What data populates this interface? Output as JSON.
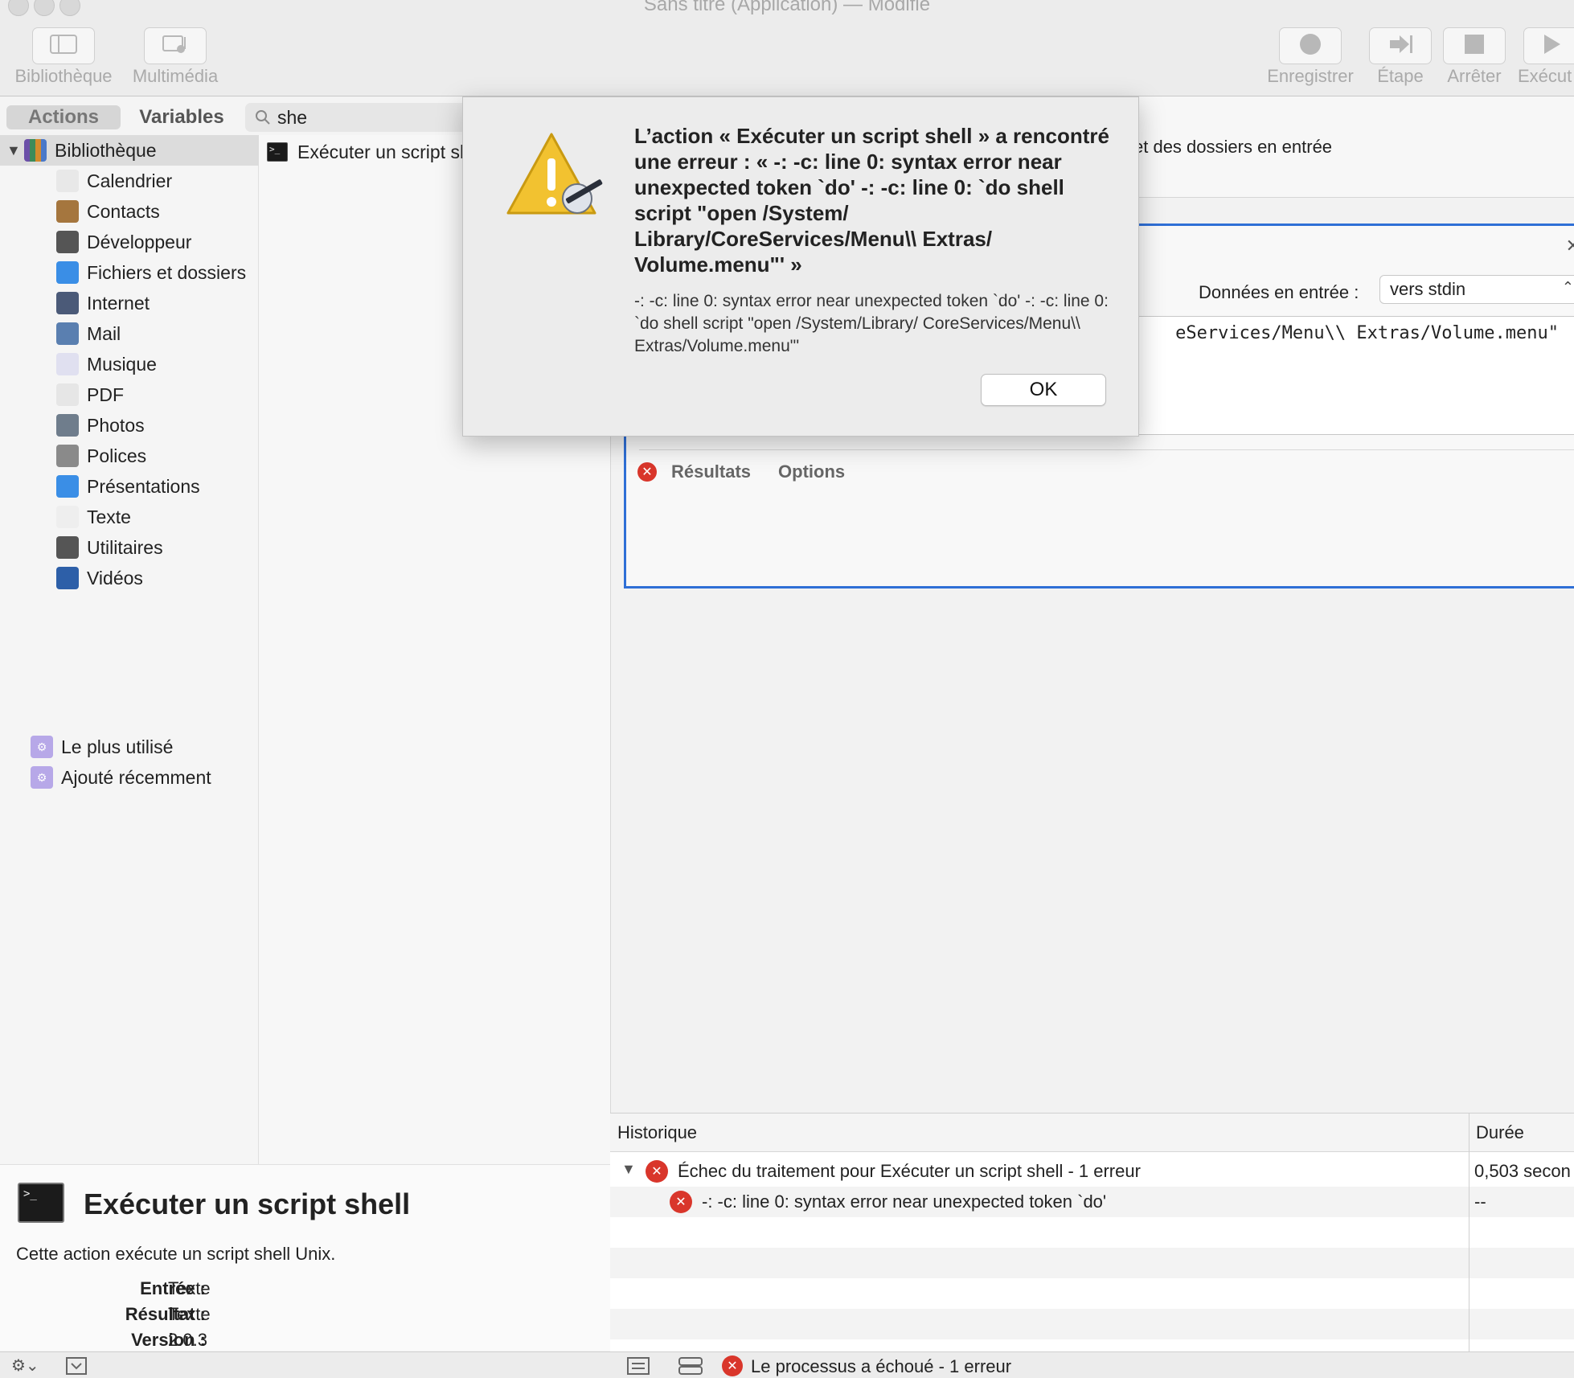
{
  "window": {
    "title": "Sans titre (Application) — Modifié"
  },
  "toolbar": {
    "left_buttons": [
      {
        "label": "Bibliothèque",
        "icon": "sidebar-icon"
      },
      {
        "label": "Multimédia",
        "icon": "media-icon"
      }
    ],
    "right_buttons": [
      {
        "label": "Enregistrer",
        "icon": "record-icon"
      },
      {
        "label": "Étape",
        "icon": "step-icon"
      },
      {
        "label": "Arrêter",
        "icon": "stop-icon"
      },
      {
        "label": "Exécut",
        "icon": "play-icon"
      }
    ]
  },
  "library": {
    "tabs": [
      "Actions",
      "Variables"
    ],
    "active_tab": "Actions",
    "search_value": "she",
    "root": "Bibliothèque",
    "categories": [
      {
        "label": "Calendrier",
        "icon": "calendar-icon",
        "color": "#e8e8e8"
      },
      {
        "label": "Contacts",
        "icon": "contacts-icon",
        "color": "#a5763e"
      },
      {
        "label": "Développeur",
        "icon": "tools-icon",
        "color": "#555555"
      },
      {
        "label": "Fichiers et dossiers",
        "icon": "finder-icon",
        "color": "#3a8ee6"
      },
      {
        "label": "Internet",
        "icon": "globe-icon",
        "color": "#4b5a78"
      },
      {
        "label": "Mail",
        "icon": "mail-icon",
        "color": "#5a7fb0"
      },
      {
        "label": "Musique",
        "icon": "music-icon",
        "color": "#e0e0f0"
      },
      {
        "label": "PDF",
        "icon": "pdf-icon",
        "color": "#e6e6e6"
      },
      {
        "label": "Photos",
        "icon": "photos-icon",
        "color": "#6f7d8c"
      },
      {
        "label": "Polices",
        "icon": "fonts-icon",
        "color": "#8a8a8a"
      },
      {
        "label": "Présentations",
        "icon": "keynote-icon",
        "color": "#3a8ee6"
      },
      {
        "label": "Texte",
        "icon": "text-icon",
        "color": "#eeeeee"
      },
      {
        "label": "Utilitaires",
        "icon": "tools-icon",
        "color": "#555555"
      },
      {
        "label": "Vidéos",
        "icon": "quicktime-icon",
        "color": "#2d5fa8"
      }
    ],
    "smart_groups": [
      {
        "label": "Le plus utilisé",
        "icon": "smart-folder-icon"
      },
      {
        "label": "Ajouté récemment",
        "icon": "smart-folder-icon"
      }
    ]
  },
  "actions_list": {
    "items": [
      "Exécuter un script shell"
    ]
  },
  "description": {
    "title": "Exécuter un script shell",
    "text": "Cette action exécute un script shell Unix.",
    "entree_label": "Entrée :",
    "entree_value": "Texte",
    "resultat_label": "Résultat :",
    "resultat_value": "Texte",
    "version_label": "Version :",
    "version_value": "2.0.3"
  },
  "workflow": {
    "header_text": "et des dossiers en entrée",
    "input_label": "Données en entrée :",
    "input_value": "vers stdin",
    "script_visible": "eServices/Menu\\\\ Extras/Volume.menu\"",
    "tabs": [
      "Résultats",
      "Options"
    ]
  },
  "history": {
    "col_history": "Historique",
    "col_duration": "Durée",
    "rows": [
      {
        "text": "Échec du traitement pour Exécuter un script shell - 1 erreur",
        "duration": "0,503 secon"
      },
      {
        "text": "-: -c: line 0: syntax error near unexpected token `do'",
        "duration": "--"
      }
    ]
  },
  "status": {
    "text": "Le processus a échoué - 1 erreur"
  },
  "dialog": {
    "title": "L’action « Exécuter un script shell » a rencontré une erreur : « -: -c: line 0: syntax error near unexpected token `do' -: -c: line 0: `do shell script \"open /System/ Library/CoreServices/Menu\\\\ Extras/ Volume.menu\"' »",
    "message": "-: -c: line 0: syntax error near unexpected token `do' -: -c: line 0: `do shell script \"open /System/Library/ CoreServices/Menu\\\\ Extras/Volume.menu\"'",
    "ok_label": "OK",
    "icon": "caution-automator-icon",
    "accent": "#f2c230"
  }
}
